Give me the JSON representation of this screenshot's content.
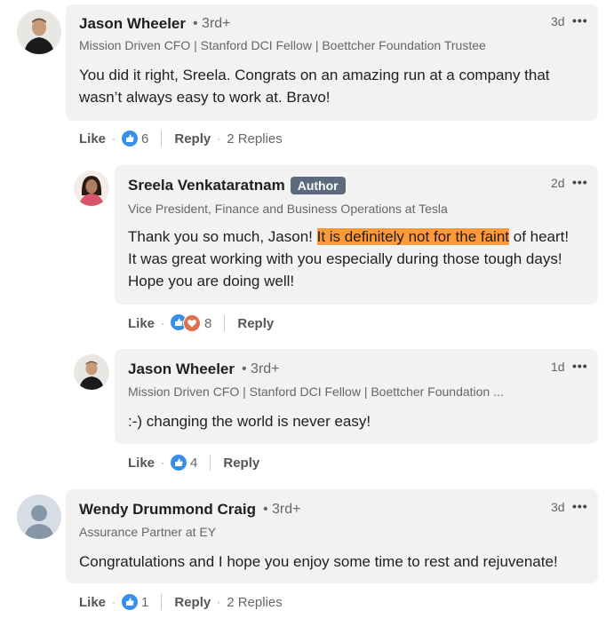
{
  "comments": [
    {
      "name": "Jason Wheeler",
      "degree": "• 3rd+",
      "headline": "Mission Driven CFO | Stanford DCI Fellow | Boettcher Foundation Trustee",
      "time": "3d",
      "text": "You did it right, Sreela. Congrats on an amazing run at a company that wasn’t always easy to work at. Bravo!",
      "like_label": "Like",
      "reaction_count": "6",
      "reply_label": "Reply",
      "replies_label": "2 Replies"
    },
    {
      "name": "Sreela Venkataratnam",
      "badge": "Author",
      "headline": "Vice President, Finance and Business Operations at Tesla",
      "time": "2d",
      "text_before": "Thank you so much, Jason! ",
      "text_highlight": "It is definitely not for the faint",
      "text_after": " of heart! It was great working with you especially during those tough days! Hope you are doing well!",
      "like_label": "Like",
      "reaction_count": "8",
      "reply_label": "Reply"
    },
    {
      "name": "Jason Wheeler",
      "degree": "• 3rd+",
      "headline": "Mission Driven CFO | Stanford DCI Fellow | Boettcher Foundation ...",
      "time": "1d",
      "text": ":-) changing the world is never easy!",
      "like_label": "Like",
      "reaction_count": "4",
      "reply_label": "Reply"
    },
    {
      "name": "Wendy Drummond Craig",
      "degree": "• 3rd+",
      "headline": "Assurance Partner at EY",
      "time": "3d",
      "text": "Congratulations and I hope you enjoy some time to rest and rejuvenate!",
      "like_label": "Like",
      "reaction_count": "1",
      "reply_label": "Reply",
      "replies_label": "2 Replies"
    }
  ],
  "more_glyph": "•••",
  "sep_dot": "·",
  "colors": {
    "bubble": "#f2f2f2",
    "like_blue": "#378fe9",
    "love_red": "#df704d",
    "highlight": "#ff9a3c",
    "badge": "#5b6b7b"
  }
}
